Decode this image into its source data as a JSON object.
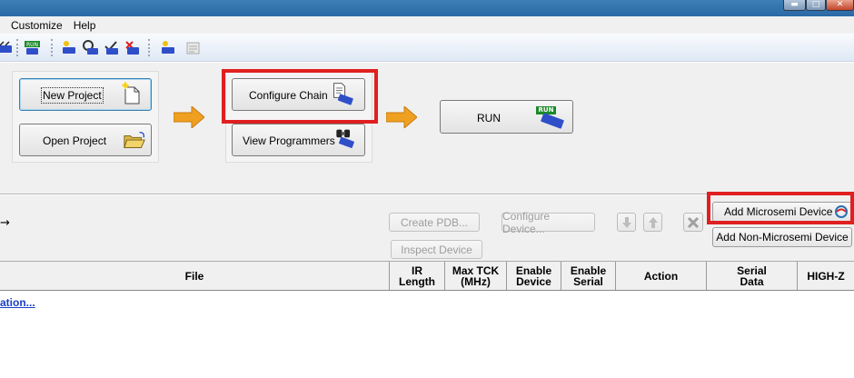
{
  "menubar": {
    "customize": "Customize",
    "help": "Help"
  },
  "workflow": {
    "new_project": "New Project",
    "open_project": "Open Project",
    "configure_chain": "Configure Chain",
    "view_programmers": "View Programmers",
    "run": "RUN",
    "run_icon_text": "RUN"
  },
  "chain": {
    "left_arrow_glyph": "→",
    "create_pdb": "Create PDB...",
    "configure_device": "Configure Device...",
    "inspect_device": "Inspect Device",
    "add_microsemi": "Add Microsemi Device",
    "add_non_microsemi": "Add Non-Microsemi Device"
  },
  "table": {
    "columns": [
      "File",
      "IR\nLength",
      "Max TCK\n(MHz)",
      "Enable\nDevice",
      "Enable\nSerial",
      "Action",
      "Serial\nData",
      "HIGH-Z"
    ],
    "link_text": "ation..."
  },
  "colors": {
    "highlight": "#e02020",
    "arrow": "#f0a020",
    "link": "#1a3fc9"
  }
}
